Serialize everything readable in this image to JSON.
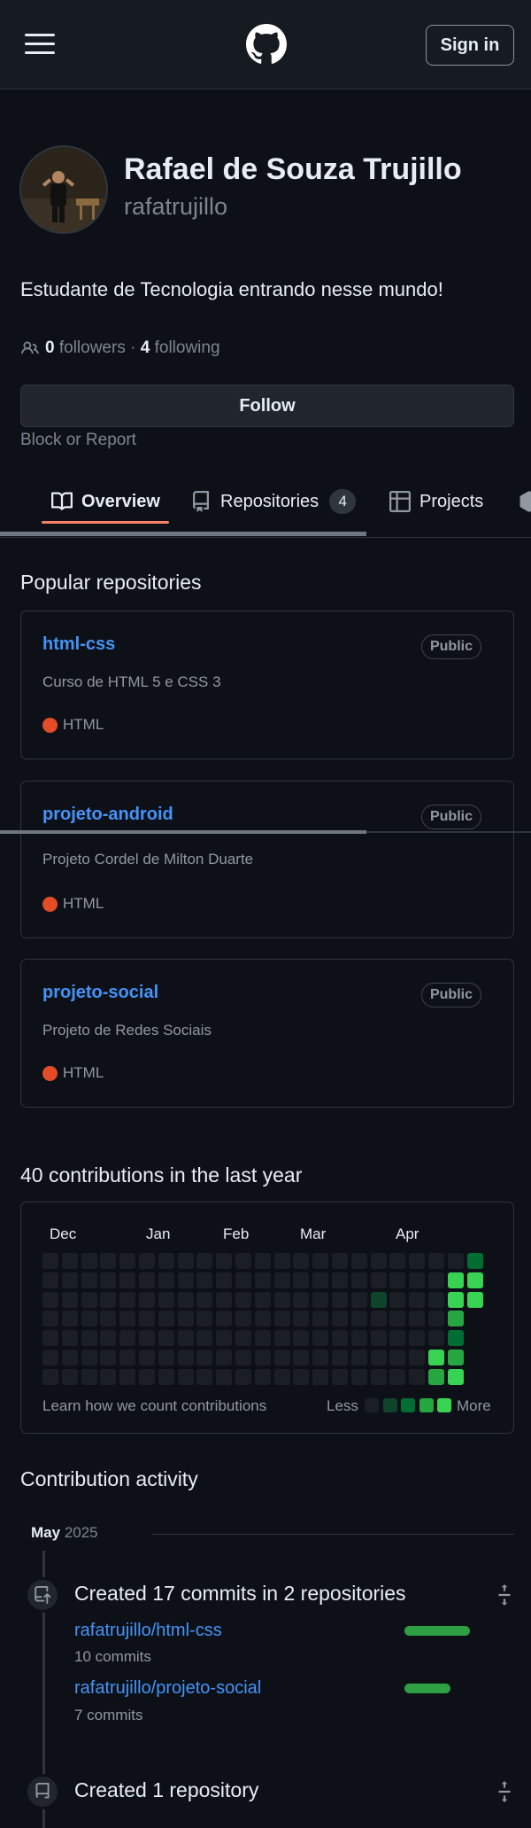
{
  "header": {
    "menu_icon": "hamburger-icon",
    "logo_icon": "github-mark-icon",
    "signin_label": "Sign in"
  },
  "profile": {
    "name": "Rafael de Souza Trujillo",
    "login": "rafatrujillo",
    "bio": "Estudante de Tecnologia entrando nesse mundo!",
    "followers_count": "0",
    "followers_label": "followers",
    "separator": "·",
    "following_count": "4",
    "following_label": "following",
    "follow_label": "Follow",
    "block_label": "Block or Report"
  },
  "tabs": [
    {
      "label": "Overview",
      "icon": "book-icon",
      "active": true
    },
    {
      "label": "Repositories",
      "icon": "repo-icon",
      "count": "4"
    },
    {
      "label": "Projects",
      "icon": "table-icon"
    }
  ],
  "popular": {
    "title": "Popular repositories",
    "repos": [
      {
        "name": "html-css",
        "visibility": "Public",
        "description": "Curso de HTML 5 e CSS 3",
        "language": "HTML",
        "language_color": "#e34c26"
      },
      {
        "name": "projeto-android",
        "visibility": "Public",
        "description": "Projeto Cordel de Milton Duarte",
        "language": "HTML",
        "language_color": "#e34c26"
      },
      {
        "name": "projeto-social",
        "visibility": "Public",
        "description": "Projeto de Redes Sociais",
        "language": "HTML",
        "language_color": "#e34c26"
      }
    ]
  },
  "contributions": {
    "title": "40 contributions in the last year",
    "months": [
      "Dec",
      "Jan",
      "Feb",
      "Mar",
      "Apr"
    ],
    "learn_label": "Learn how we count contributions",
    "less_label": "Less",
    "more_label": "More",
    "colors": {
      "empty": "#1a1f26",
      "l1": "#0e4429",
      "l2": "#006d32",
      "l3": "#26a641",
      "l4": "#39d353"
    }
  },
  "activity": {
    "title": "Contribution activity",
    "month": "May",
    "year": "2025",
    "items": [
      {
        "icon": "repo-push-icon",
        "title": "Created 17 commits in 2 repositories",
        "repos": [
          {
            "name": "rafatrujillo/html-css",
            "commits": "10 commits",
            "fraction": 1.0
          },
          {
            "name": "rafatrujillo/projeto-social",
            "commits": "7 commits",
            "fraction": 0.7
          }
        ]
      },
      {
        "icon": "repo-icon",
        "title": "Created 1 repository"
      }
    ]
  }
}
